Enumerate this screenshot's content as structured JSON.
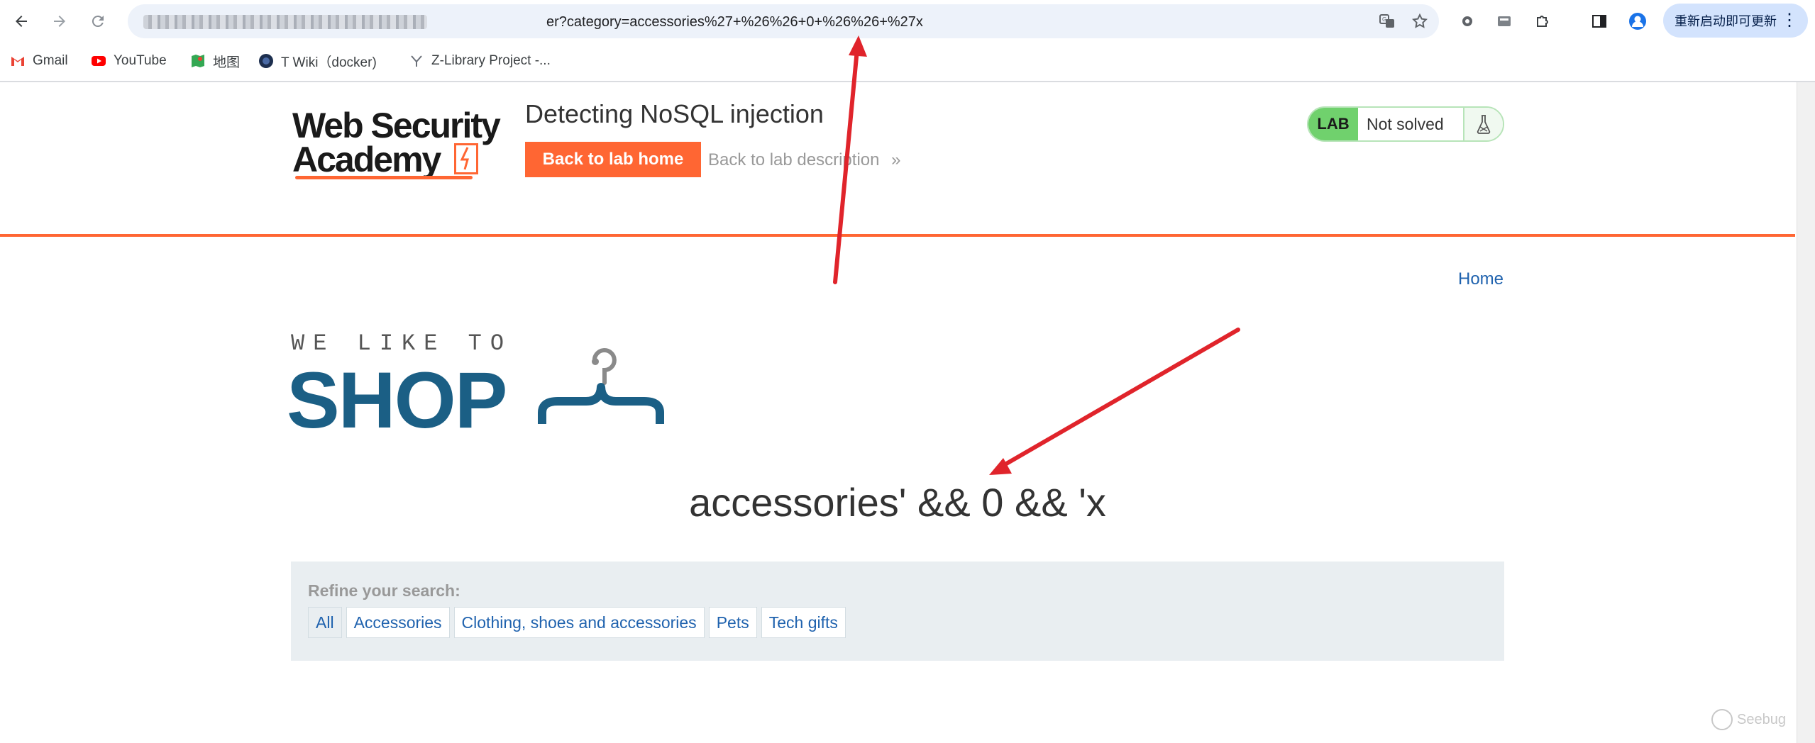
{
  "browser": {
    "url_visible": "er?category=accessories%27+%26%26+0+%26%26+%27x",
    "update_button_label": "重新启动即可更新",
    "bookmarks": [
      {
        "label": "Gmail",
        "icon": "gmail-icon"
      },
      {
        "label": "YouTube",
        "icon": "youtube-icon"
      },
      {
        "label": "地图",
        "icon": "maps-icon"
      },
      {
        "label": "T Wiki（docker)",
        "icon": "wiki-icon"
      },
      {
        "label": "Z-Library Project -...",
        "icon": "zlibrary-icon"
      }
    ]
  },
  "lab": {
    "logo_line1": "Web Security",
    "logo_line2": "Academy",
    "title": "Detecting NoSQL injection",
    "back_home_label": "Back to lab home",
    "back_description_label": "Back to lab description",
    "status_badge": "LAB",
    "status_text": "Not solved"
  },
  "shop": {
    "home_link": "Home",
    "tagline": "WE LIKE TO",
    "brand": "SHOP",
    "heading": "accessories' && 0 && 'x",
    "refine_label": "Refine your search:",
    "filters": [
      "All",
      "Accessories",
      "Clothing, shoes and accessories",
      "Pets",
      "Tech gifts"
    ]
  },
  "watermark": "Seebug",
  "colors": {
    "accent": "#ff6633",
    "link": "#1f62ae",
    "shop_blue": "#1b5f85",
    "lab_green": "#70d16d",
    "annotation_red": "#e0242b"
  }
}
